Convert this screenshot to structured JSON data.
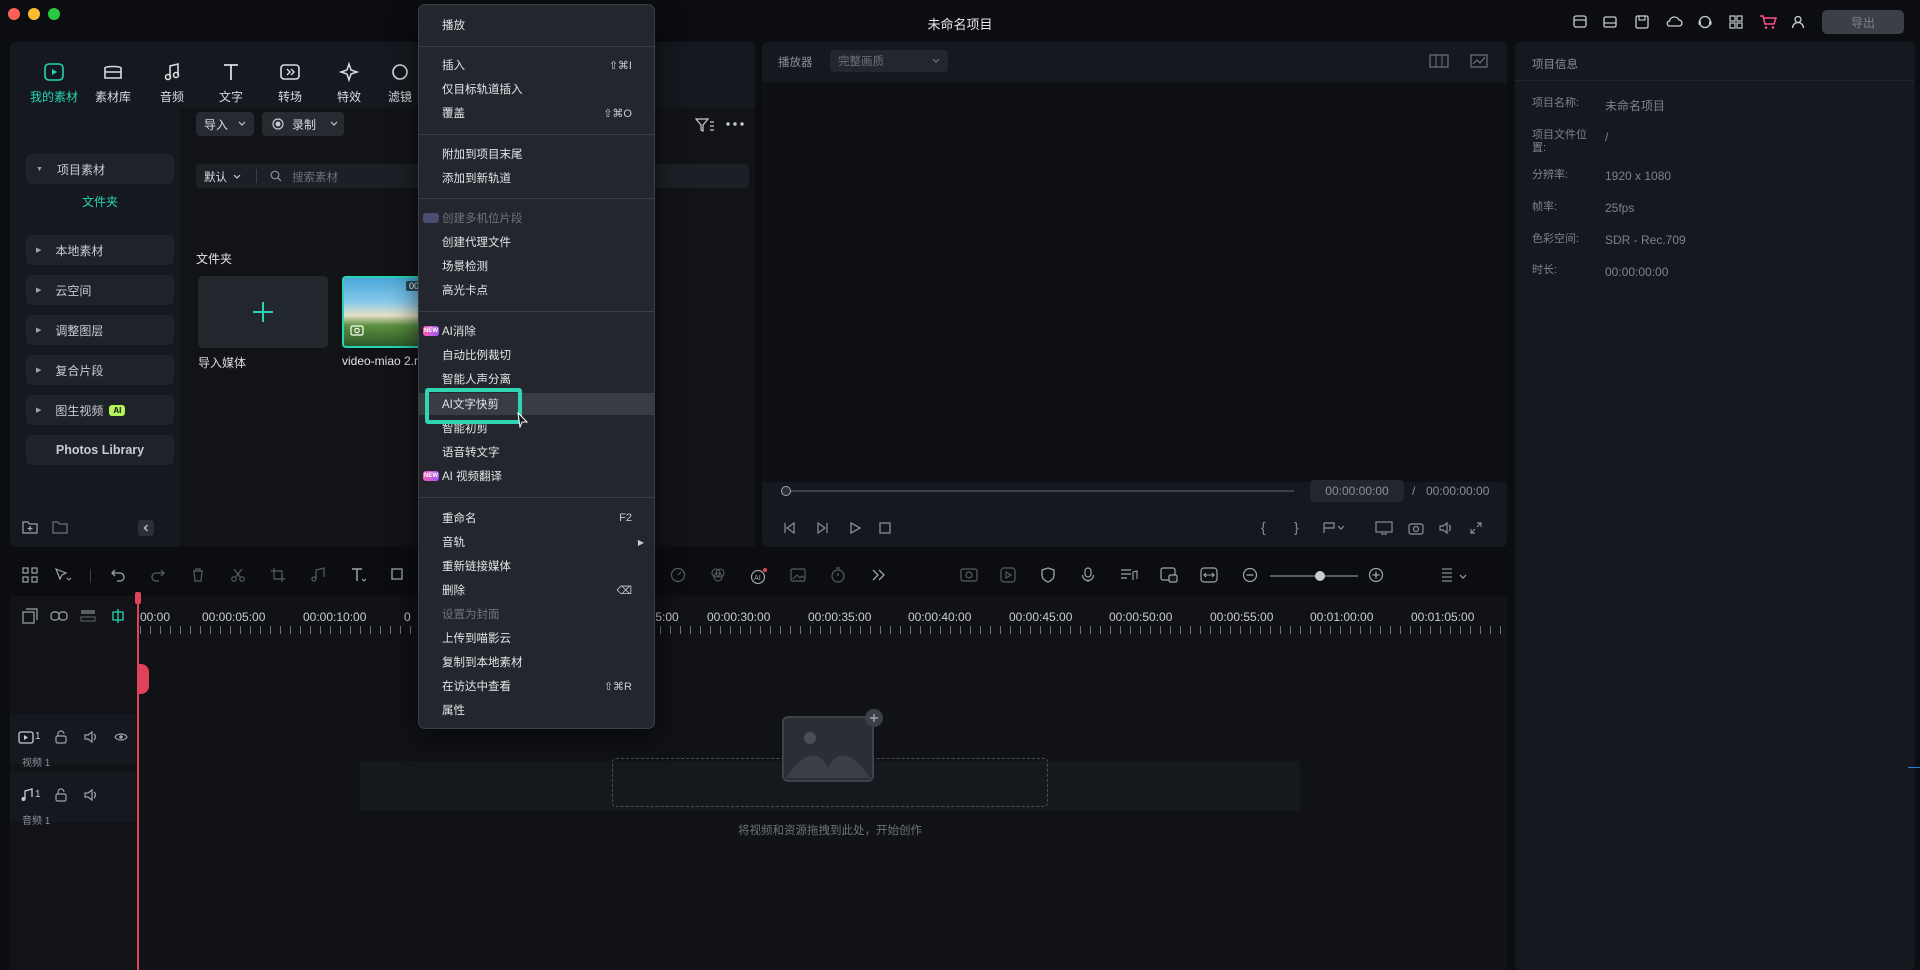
{
  "window": {
    "title": "未命名项目",
    "export_label": "导出"
  },
  "media": {
    "tabs": [
      "我的素材",
      "素材库",
      "音频",
      "文字",
      "转场",
      "特效",
      "滤镜"
    ],
    "sidebar": {
      "project_media": "项目素材",
      "folder": "文件夹",
      "local_media": "本地素材",
      "cloud": "云空间",
      "adjustment_layer": "调整图层",
      "compound_clip": "复合片段",
      "image_to_video": "图生视频",
      "ai_badge": "AI",
      "photos_library": "Photos Library"
    },
    "import_label": "导入",
    "record_label": "录制",
    "sort_label": "默认",
    "search_placeholder": "搜索素材",
    "folder_heading": "文件夹",
    "import_media_label": "导入媒体",
    "clip_name": "video-miao 2.m",
    "clip_duration": "00:"
  },
  "context_menu": {
    "play": "播放",
    "insert": "插入",
    "insert_shortcut": "⇧⌘I",
    "insert_selected_track": "仅目标轨道插入",
    "overwrite": "覆盖",
    "overwrite_shortcut": "⇧⌘O",
    "append_end": "附加到项目末尾",
    "add_new_track": "添加到新轨道",
    "create_multicam": "创建多机位片段",
    "create_proxy": "创建代理文件",
    "scene_detect": "场景检测",
    "highlight_beats": "高光卡点",
    "ai_remove": "AI消除",
    "auto_reframe": "自动比例裁切",
    "vocal_separation": "智能人声分离",
    "ai_text_edit": "AI文字快剪",
    "smart_cut": "智能初剪",
    "speech_to_text": "语音转文字",
    "ai_video_translate": "AI 视频翻译",
    "rename": "重命名",
    "rename_shortcut": "F2",
    "audio_track": "音轨",
    "relink_media": "重新链接媒体",
    "delete": "删除",
    "delete_shortcut": "⌫",
    "set_as_cover": "设置为封面",
    "upload_cloud": "上传到喵影云",
    "copy_local": "复制到本地素材",
    "reveal_finder": "在访达中查看",
    "reveal_shortcut": "⇧⌘R",
    "properties": "属性",
    "new_tag": "NEW"
  },
  "player": {
    "label": "播放器",
    "quality": "完整画质",
    "current_time": "00:00:00:00",
    "separator": "/",
    "total_time": "00:00:00:00"
  },
  "info": {
    "title": "项目信息",
    "name_label": "项目名称:",
    "name_value": "未命名项目",
    "location_label_1": "项目文件位",
    "location_label_2": "置:",
    "location_value": "/",
    "resolution_label": "分辨率:",
    "resolution_value": "1920 x 1080",
    "fps_label": "帧率:",
    "fps_value": "25fps",
    "colorspace_label": "色彩空间:",
    "colorspace_value": "SDR - Rec.709",
    "duration_label": "时长:",
    "duration_value": "00:00:00:00"
  },
  "timeline": {
    "ruler": [
      "00:00",
      "00:00:05:00",
      "00:00:10:00",
      "0",
      ":5:00",
      "00:00:30:00",
      "00:00:35:00",
      "00:00:40:00",
      "00:00:45:00",
      "00:00:50:00",
      "00:00:55:00",
      "00:01:00:00",
      "00:01:05:00"
    ],
    "video_track_num": "1",
    "video_track_label": "视频 1",
    "audio_track_num": "1",
    "audio_track_label": "音频 1",
    "drop_hint": "将视频和资源拖拽到此处，开始创作"
  },
  "colors": {
    "accent": "#25d6b3",
    "highlight_border": "#31d5b4",
    "playhead": "#e0425a"
  }
}
